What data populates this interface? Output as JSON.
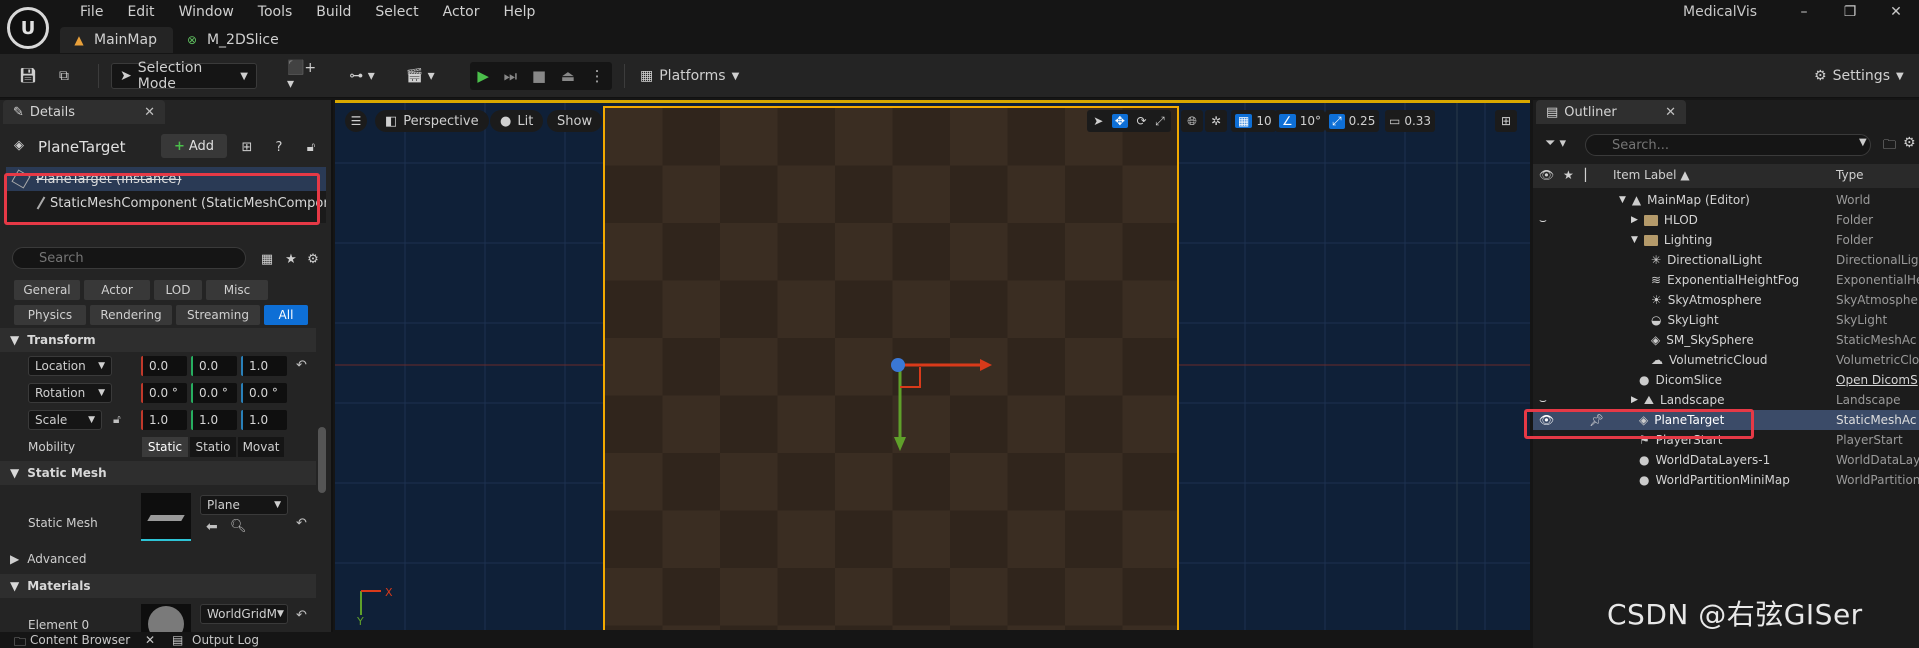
{
  "app_title": "MedicalVis",
  "menu": [
    "File",
    "Edit",
    "Window",
    "Tools",
    "Build",
    "Select",
    "Actor",
    "Help"
  ],
  "window_controls": [
    "–",
    "❐",
    "✕"
  ],
  "tabs": [
    {
      "label": "MainMap",
      "active": true
    },
    {
      "label": "M_2DSlice",
      "active": false
    }
  ],
  "toolbar": {
    "selection_mode": "Selection Mode",
    "platforms": "Platforms",
    "settings": "Settings"
  },
  "details": {
    "tab_label": "Details",
    "actor_name": "PlaneTarget",
    "add_label": "Add",
    "components": [
      "PlaneTarget (Instance)",
      "StaticMeshComponent (StaticMeshComponent)"
    ],
    "search_placeholder": "Search",
    "filters_row1": [
      "General",
      "Actor",
      "LOD",
      "Misc"
    ],
    "filters_row2": [
      "Physics",
      "Rendering",
      "Streaming",
      "All"
    ],
    "active_filter": "All",
    "transform": {
      "section": "Transform",
      "location": {
        "label": "Location",
        "x": "0.0",
        "y": "0.0",
        "z": "1.0"
      },
      "rotation": {
        "label": "Rotation",
        "x": "0.0 °",
        "y": "0.0 °",
        "z": "0.0 °"
      },
      "scale": {
        "label": "Scale",
        "x": "1.0",
        "y": "1.0",
        "z": "1.0"
      },
      "mobility_label": "Mobility",
      "mobility_options": [
        "Static",
        "Statio",
        "Movat"
      ],
      "mobility_selected": "Static"
    },
    "static_mesh": {
      "section": "Static Mesh",
      "label": "Static Mesh",
      "value": "Plane"
    },
    "advanced": "Advanced",
    "materials": {
      "section": "Materials",
      "element_label": "Element 0",
      "value": "WorldGridM"
    }
  },
  "viewport": {
    "perspective": "Perspective",
    "lit": "Lit",
    "show": "Show",
    "grid_snap": "10",
    "rotation_snap": "10°",
    "scale_snap": "0.25",
    "camera_speed": "0.33",
    "axis_x": "X",
    "axis_y": "Y"
  },
  "outliner": {
    "tab_label": "Outliner",
    "search_placeholder": "Search...",
    "col_label": "Item Label ▲",
    "col_type": "Type",
    "rows": [
      {
        "label": "MainMap (Editor)",
        "type": "World"
      },
      {
        "label": "HLOD",
        "type": "Folder"
      },
      {
        "label": "Lighting",
        "type": "Folder"
      },
      {
        "label": "DirectionalLight",
        "type": "DirectionalLig"
      },
      {
        "label": "ExponentialHeightFog",
        "type": "ExponentialHe"
      },
      {
        "label": "SkyAtmosphere",
        "type": "SkyAtmosphe"
      },
      {
        "label": "SkyLight",
        "type": "SkyLight"
      },
      {
        "label": "SM_SkySphere",
        "type": "StaticMeshAc"
      },
      {
        "label": "VolumetricCloud",
        "type": "VolumetricClo"
      },
      {
        "label": "DicomSlice",
        "type": "Open DicomS"
      },
      {
        "label": "Landscape",
        "type": "Landscape"
      },
      {
        "label": "PlaneTarget",
        "type": "StaticMeshAc"
      },
      {
        "label": "PlayerStart",
        "type": "PlayerStart"
      },
      {
        "label": "WorldDataLayers-1",
        "type": "WorldDataLay"
      },
      {
        "label": "WorldPartitionMiniMap",
        "type": "WorldPartition"
      }
    ]
  },
  "bottom": {
    "content_browser": "Content Browser",
    "output_log": "Output Log"
  },
  "watermark": "CSDN @右弦GISer"
}
